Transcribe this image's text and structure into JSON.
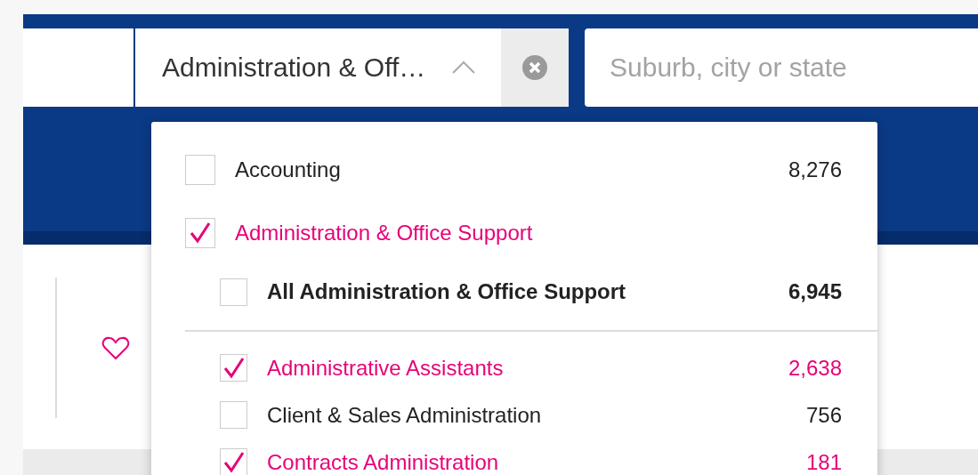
{
  "search": {
    "classification": {
      "value": "Administration & Off…",
      "expanded": true
    },
    "location": {
      "placeholder": "Suburb, city or state"
    }
  },
  "dropdown": {
    "items": [
      {
        "label": "Accounting",
        "count": "8,276",
        "checked": false
      },
      {
        "label": "Administration & Office Support",
        "checked": true,
        "children": [
          {
            "kind": "all",
            "label": "All Administration & Office Support",
            "count": "6,945",
            "checked": false
          },
          {
            "kind": "sub",
            "label": "Administrative Assistants",
            "count": "2,638",
            "checked": true
          },
          {
            "kind": "sub",
            "label": "Client & Sales Administration",
            "count": "756",
            "checked": false
          },
          {
            "kind": "sub",
            "label": "Contracts Administration",
            "count": "181",
            "checked": true
          }
        ]
      }
    ]
  }
}
